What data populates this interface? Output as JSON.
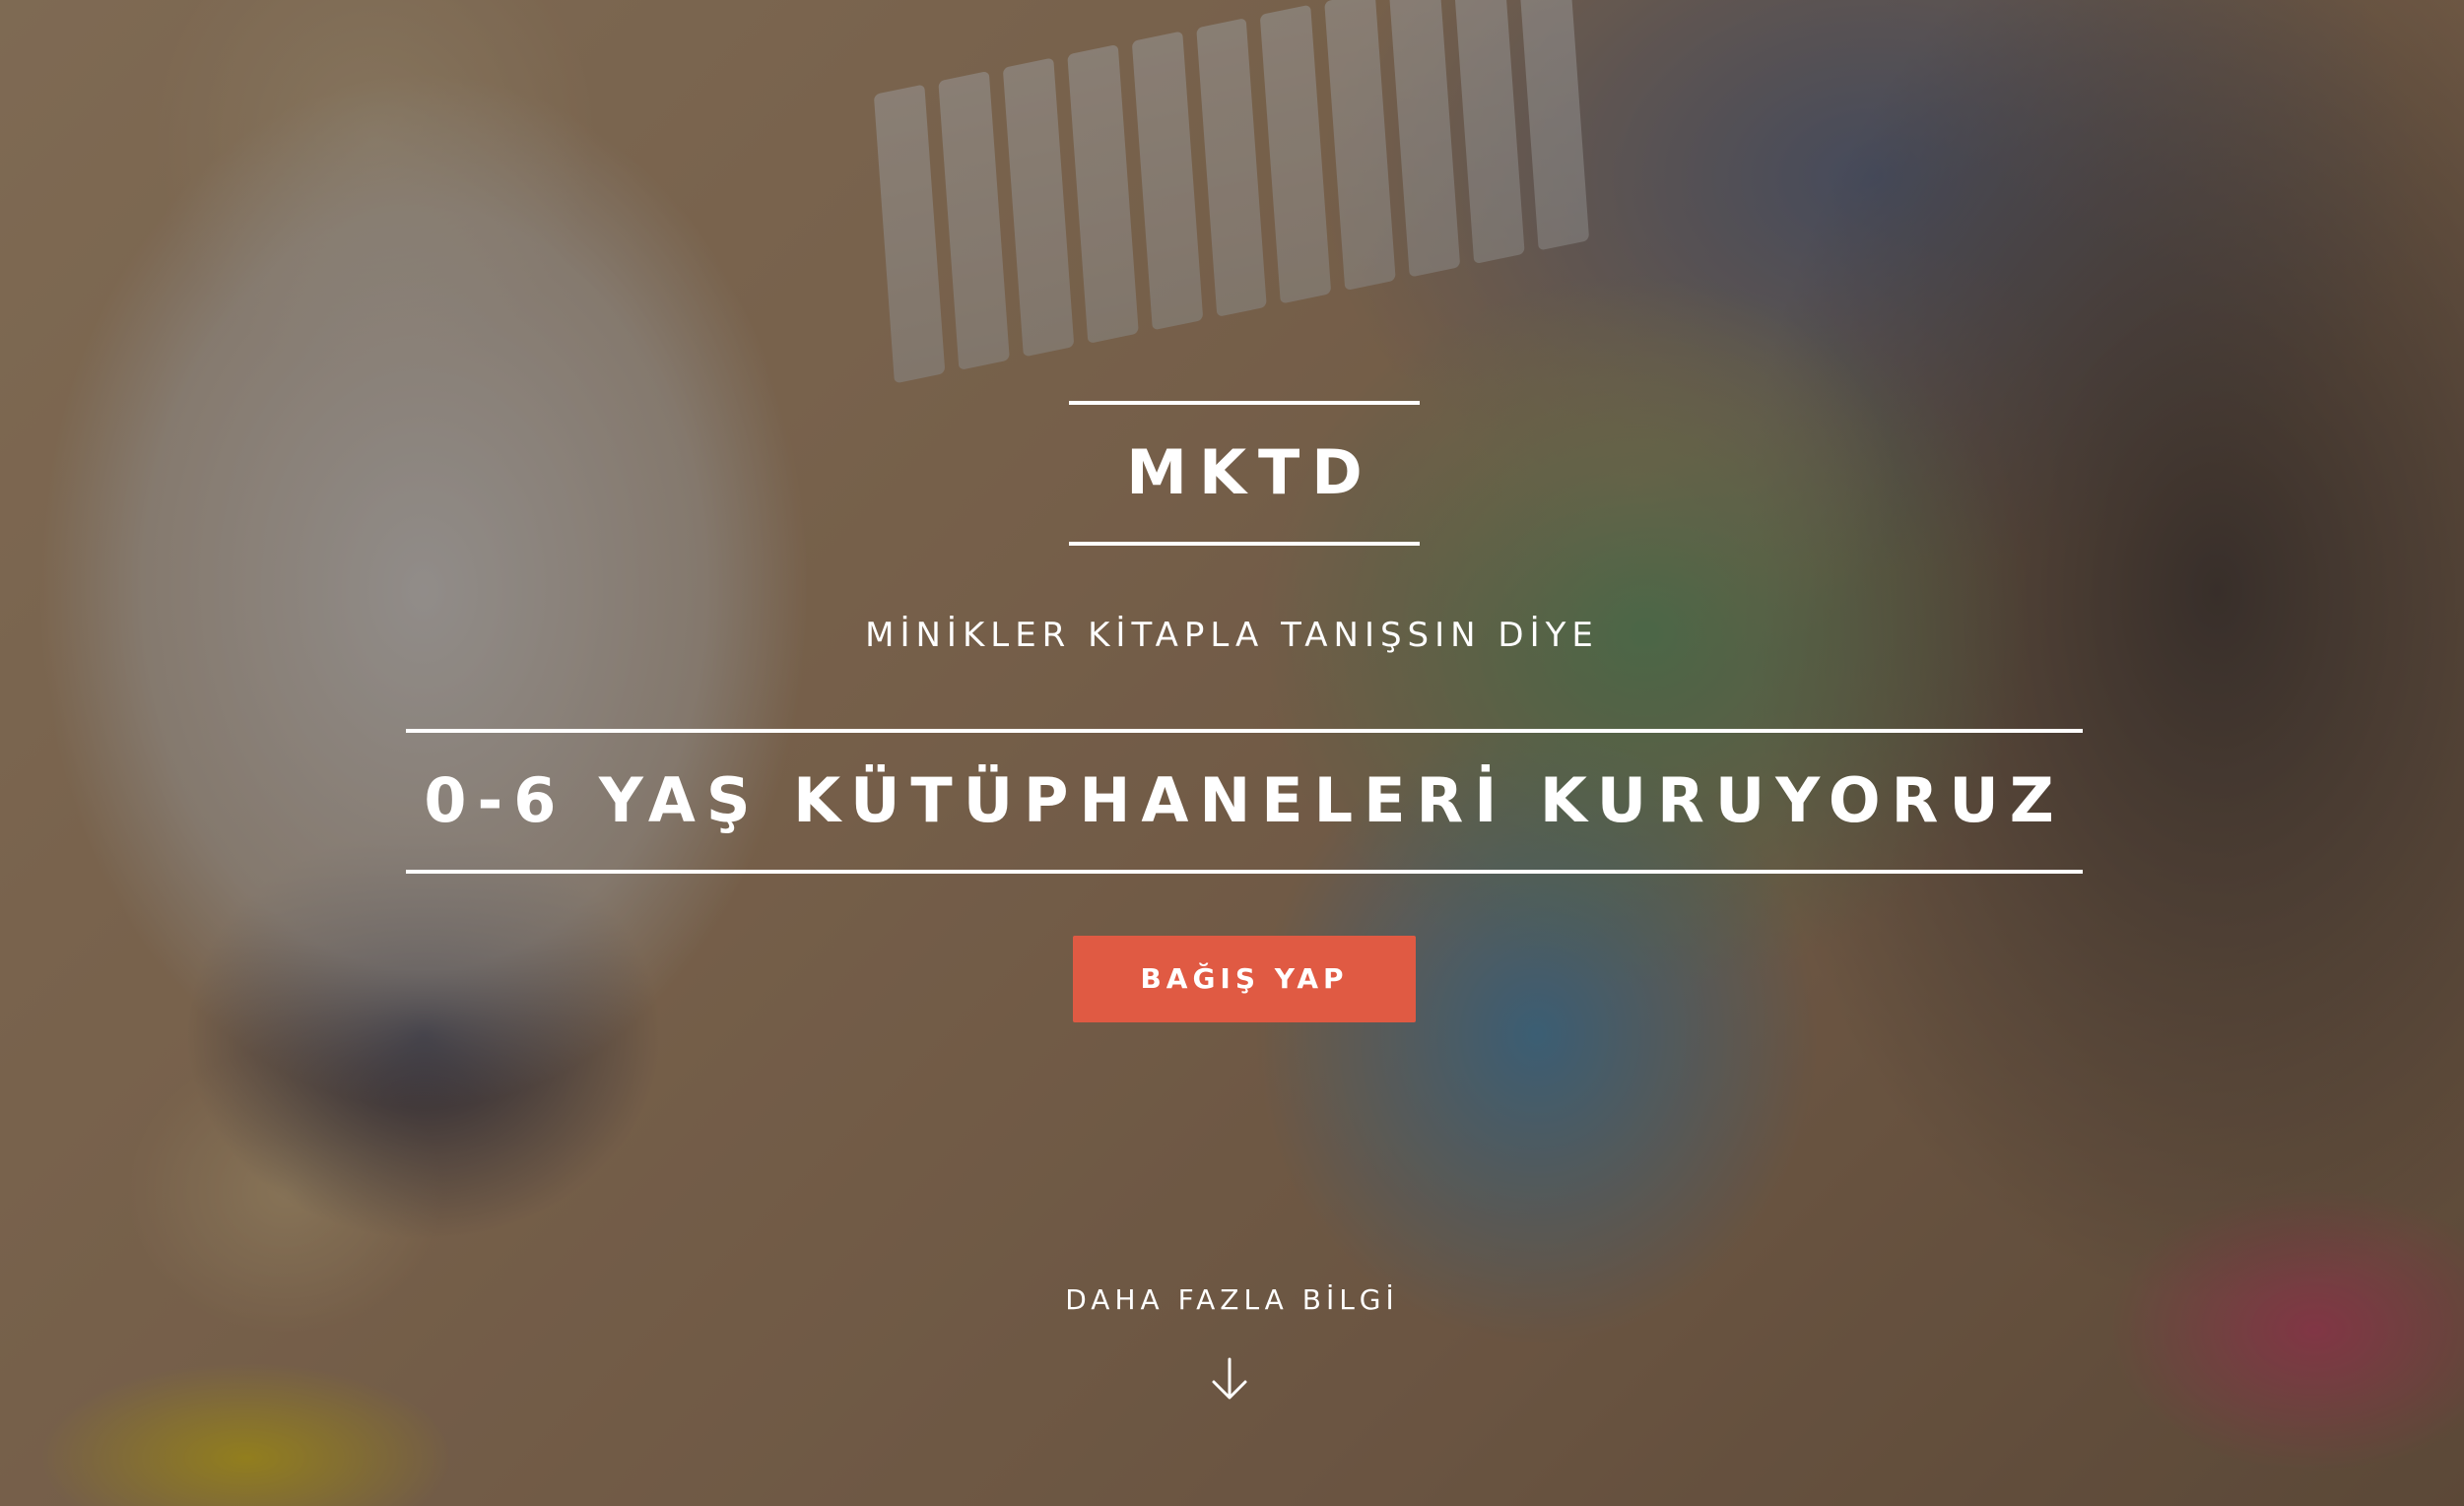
{
  "hero": {
    "brand": "MKTD",
    "tagline": "MİNİKLER KİTAPLA TANIŞSIN DİYE",
    "headline": "0-6 YAŞ KÜTÜPHANELERİ KURUYORUZ",
    "donate_label": "BAĞIŞ YAP",
    "more_label": "DAHA FAZLA BİLGİ",
    "scroll_icon": "arrow-down-icon"
  },
  "colors": {
    "accent": "#e05a43",
    "text": "#ffffff",
    "overlay": "rgba(25,20,18,0.42)"
  }
}
